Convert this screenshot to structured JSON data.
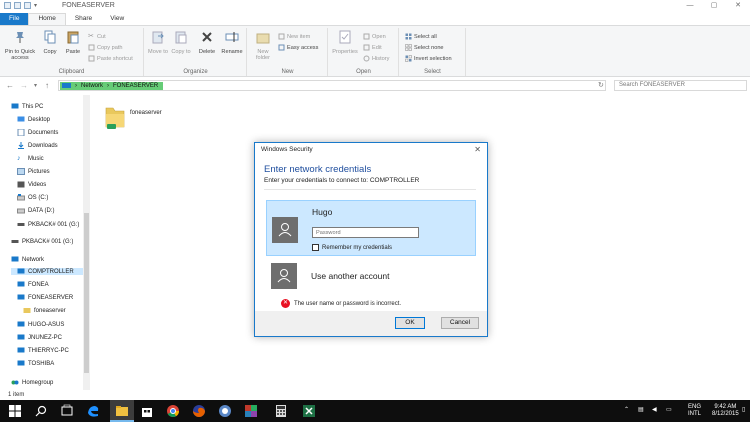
{
  "window": {
    "title": "FONEASERVER",
    "controls": [
      "—",
      "▢",
      "✕"
    ]
  },
  "tabs": [
    {
      "label": "File"
    },
    {
      "label": "Home"
    },
    {
      "label": "Share"
    },
    {
      "label": "View"
    }
  ],
  "ribbon": {
    "clipboard": {
      "label": "Clipboard",
      "pin": "Pin to Quick access",
      "copy": "Copy",
      "paste": "Paste",
      "cut": "Cut",
      "copy_path": "Copy path",
      "paste_shortcut": "Paste shortcut"
    },
    "organize": {
      "label": "Organize",
      "move_to": "Move to",
      "copy_to": "Copy to",
      "delete": "Delete",
      "rename": "Rename"
    },
    "new": {
      "label": "New",
      "new_folder": "New folder",
      "new_item": "New item",
      "easy_access": "Easy access"
    },
    "open": {
      "label": "Open",
      "properties": "Properties",
      "open": "Open",
      "edit": "Edit",
      "history": "History"
    },
    "select": {
      "label": "Select",
      "select_all": "Select all",
      "select_none": "Select none",
      "invert": "Invert selection"
    }
  },
  "address": {
    "crumbs": [
      "Network",
      "FONEASERVER"
    ],
    "search_placeholder": "Search FONEASERVER"
  },
  "nav": {
    "this_pc": "This PC",
    "desktop": "Desktop",
    "documents": "Documents",
    "downloads": "Downloads",
    "music": "Music",
    "pictures": "Pictures",
    "videos": "Videos",
    "os_c": "OS (C:)",
    "data_d": "DATA (D:)",
    "pkback1": "PKBACK# 001 (G:)",
    "pkback2": "PKBACK# 001 (G:)",
    "network": "Network",
    "comptroller": "COMPTROLLER",
    "fonea": "FONEA",
    "foneaserver": "FONEASERVER",
    "foneaserver_share": "foneaserver",
    "hugo_asus": "HUGO-ASUS",
    "jnunez_pc": "JNUNEZ-PC",
    "thierryc_pc": "THIERRYC-PC",
    "toshiba": "TOSHIBA",
    "homegroup": "Homegroup"
  },
  "content": {
    "folder_name": "foneaserver"
  },
  "status": {
    "item_count": "1 item"
  },
  "dialog": {
    "title": "Windows Security",
    "heading": "Enter network credentials",
    "subtitle": "Enter your credentials to connect to: COMPTROLLER",
    "username": "Hugo",
    "password_placeholder": "Password",
    "remember": "Remember my credentials",
    "other_account": "Use another account",
    "error": "The user name or password is incorrect.",
    "ok": "OK",
    "cancel": "Cancel"
  },
  "taskbar": {
    "lang": "ENG",
    "locale": "INTL",
    "time": "9:42 AM",
    "date": "8/12/2015"
  },
  "colors": {
    "accent": "#1979ca",
    "selection": "#cce8ff",
    "breadcrumb": "#66cc77",
    "error": "#e81123",
    "taskbar": "#0e0e0e"
  }
}
